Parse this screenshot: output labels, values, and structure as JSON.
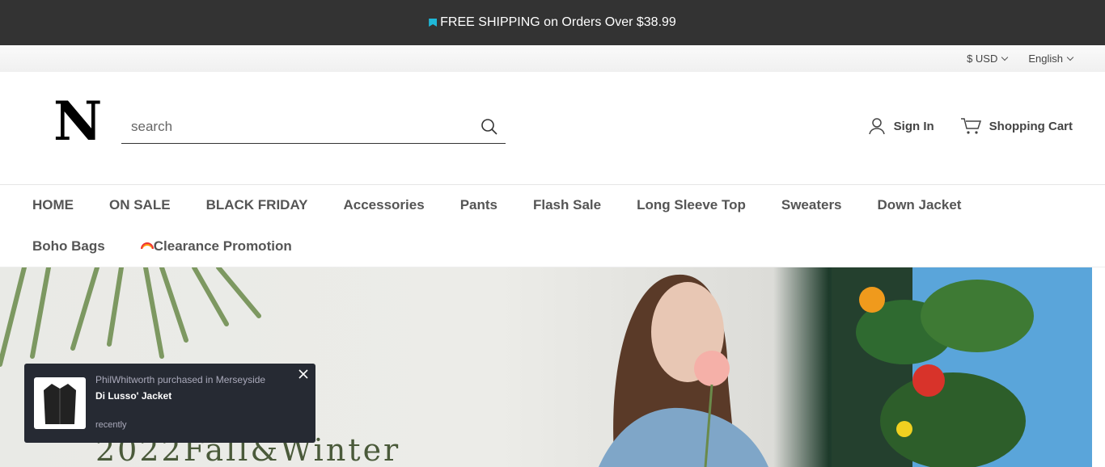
{
  "announcement": {
    "text": "FREE SHIPPING on Orders Over $38.99",
    "flag_color": "#1fb8d8"
  },
  "utility": {
    "currency": "$ USD",
    "language": "English"
  },
  "header": {
    "logo": "N",
    "search_placeholder": "search",
    "sign_in": "Sign In",
    "cart": "Shopping Cart"
  },
  "nav": {
    "items": [
      "HOME",
      "ON SALE",
      "BLACK FRIDAY",
      "Accessories",
      "Pants",
      "Flash Sale",
      "Long Sleeve Top",
      "Sweaters",
      "Down Jacket",
      "Boho Bags"
    ],
    "promo": "Clearance Promotion"
  },
  "hero": {
    "headline": "2022Fall&Winter"
  },
  "toast": {
    "who": "PhilWhitworth purchased in Merseyside",
    "product": "Di Lusso' Jacket",
    "when": "recently"
  },
  "colors": {
    "topbar": "#333333",
    "toast_bg": "#262a33",
    "text_dark": "#444444"
  },
  "icons": [
    "flag-icon",
    "chevron-down-icon",
    "search-icon",
    "user-icon",
    "cart-icon",
    "rainbow-icon",
    "close-icon"
  ]
}
